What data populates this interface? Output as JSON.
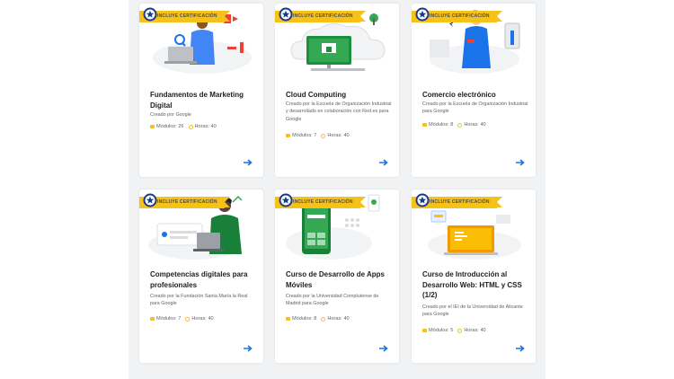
{
  "ribbon_label": "INCLUYE CERTIFICACIÓN",
  "modules_label": "Módulos:",
  "hours_label": "Horas:",
  "icons": [
    "certification-badge-icon",
    "modules-icon",
    "clock-icon",
    "arrow-right-icon"
  ],
  "colors": {
    "ribbon": "#f6c219",
    "arrow": "#1a73e8",
    "google_green": "#188038",
    "background": "#f1f2f4"
  },
  "courses": [
    {
      "title": "Fundamentos de Marketing Digital",
      "description": "Creado por Google",
      "modules": "26",
      "hours": "40"
    },
    {
      "title": "Cloud Computing",
      "description": "Creado por la Escuela de Organización Industrial y desarrollado en colaboración con Red.es para Google",
      "modules": "7",
      "hours": "40"
    },
    {
      "title": "Comercio electrónico",
      "description": "Creado por la Escuela de Organización Industrial para Google",
      "modules": "8",
      "hours": "40"
    },
    {
      "title": "Competencias digitales para profesionales",
      "description": "Creado por la Fundación Santa María la Real para Google",
      "modules": "7",
      "hours": "40"
    },
    {
      "title": "Curso de Desarrollo de Apps Móviles",
      "description": "Creado por la Universidad Complutense de Madrid para Google",
      "modules": "8",
      "hours": "40"
    },
    {
      "title": "Curso de Introducción al Desarrollo Web: HTML y CSS (1/2)",
      "description": "Creado por el IEI de la Universidad de Alicante para Google",
      "modules": "5",
      "hours": "40"
    }
  ]
}
